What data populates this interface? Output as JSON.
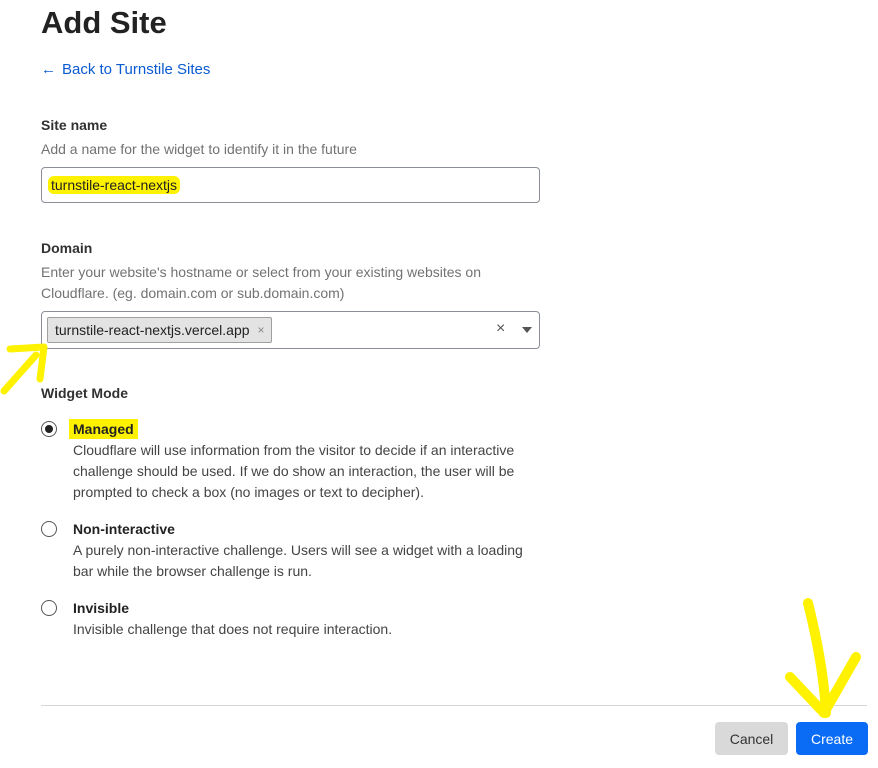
{
  "page": {
    "title": "Add Site"
  },
  "nav": {
    "back_label": "Back to Turnstile Sites",
    "back_icon": "arrow-left-icon"
  },
  "site_name": {
    "label": "Site name",
    "help": "Add a name for the widget to identify it in the future",
    "value": "turnstile-react-nextjs"
  },
  "domain": {
    "label": "Domain",
    "help": "Enter your website's hostname or select from your existing websites on Cloudflare. (eg. domain.com or sub.domain.com)",
    "chips": [
      "turnstile-react-nextjs.vercel.app"
    ],
    "chip_remove": "×",
    "clear": "×"
  },
  "widget_mode": {
    "label": "Widget Mode",
    "selected": "managed",
    "options": [
      {
        "id": "managed",
        "title": "Managed",
        "description": "Cloudflare will use information from the visitor to decide if an interactive challenge should be used. If we do show an interaction, the user will be prompted to check a box (no images or text to decipher)."
      },
      {
        "id": "non-interactive",
        "title": "Non-interactive",
        "description": "A purely non-interactive challenge. Users will see a widget with a loading bar while the browser challenge is run."
      },
      {
        "id": "invisible",
        "title": "Invisible",
        "description": "Invisible challenge that does not require interaction."
      }
    ]
  },
  "actions": {
    "cancel_label": "Cancel",
    "create_label": "Create"
  },
  "colors": {
    "link": "#0a5bd1",
    "primary": "#0a6cf5",
    "highlight": "#fff200"
  }
}
